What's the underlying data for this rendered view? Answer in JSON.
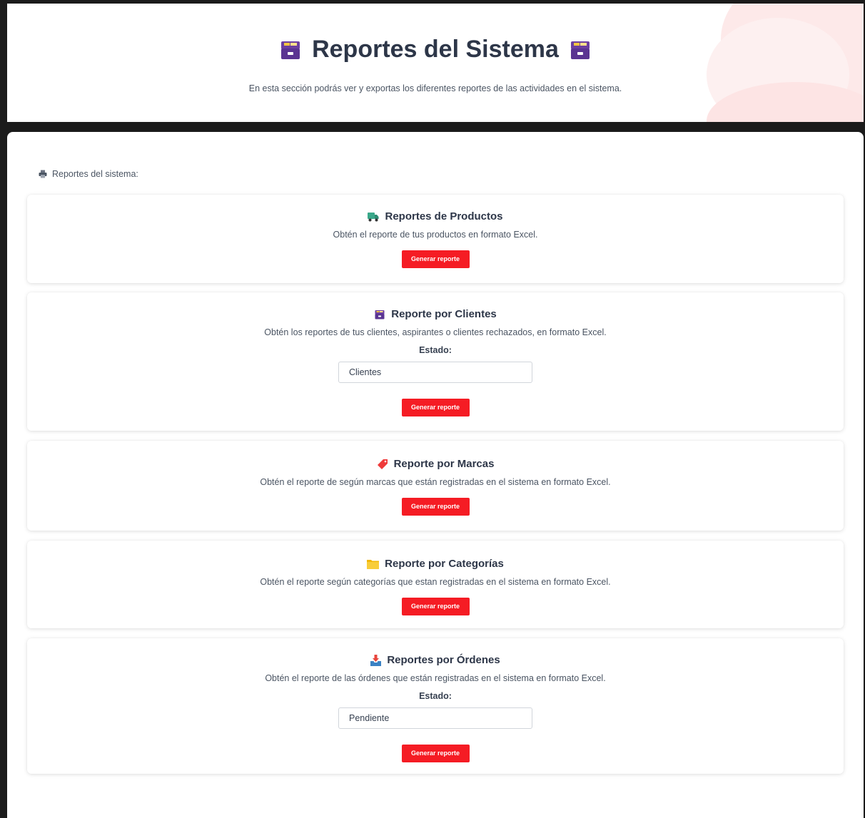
{
  "header": {
    "title": "Reportes del Sistema",
    "subtitle": "En esta sección podrás ver y exportas los diferentes reportes de las actividades en el sistema."
  },
  "section_label": "Reportes del sistema:",
  "cards": [
    {
      "title": "Reportes de Productos",
      "icon": "truck-icon",
      "description": "Obtén el reporte de tus productos en formato Excel.",
      "button_label": "Generar reporte"
    },
    {
      "title": "Reporte por Clientes",
      "icon": "card-file-box-icon",
      "description": "Obtén los reportes de tus clientes, aspirantes o clientes rechazados, en formato Excel.",
      "estado_label": "Estado:",
      "select_value": "Clientes",
      "button_label": "Generar reporte"
    },
    {
      "title": "Reporte por Marcas",
      "icon": "tag-icon",
      "description": "Obtén el reporte de según marcas que están registradas en el sistema en formato Excel.",
      "button_label": "Generar reporte"
    },
    {
      "title": "Reporte por Categorías",
      "icon": "folder-icon",
      "description": "Obtén el reporte según categorías que estan registradas en el sistema en formato Excel.",
      "button_label": "Generar reporte"
    },
    {
      "title": "Reportes por Órdenes",
      "icon": "inbox-tray-icon",
      "description": "Obtén el reporte de las órdenes que están registradas en el sistema en formato Excel.",
      "estado_label": "Estado:",
      "select_value": "Pendiente",
      "button_label": "Generar reporte"
    }
  ],
  "colors": {
    "accent_button": "#f51c24",
    "background_dark": "#1b1b1b",
    "text_heading": "#2d3648"
  }
}
